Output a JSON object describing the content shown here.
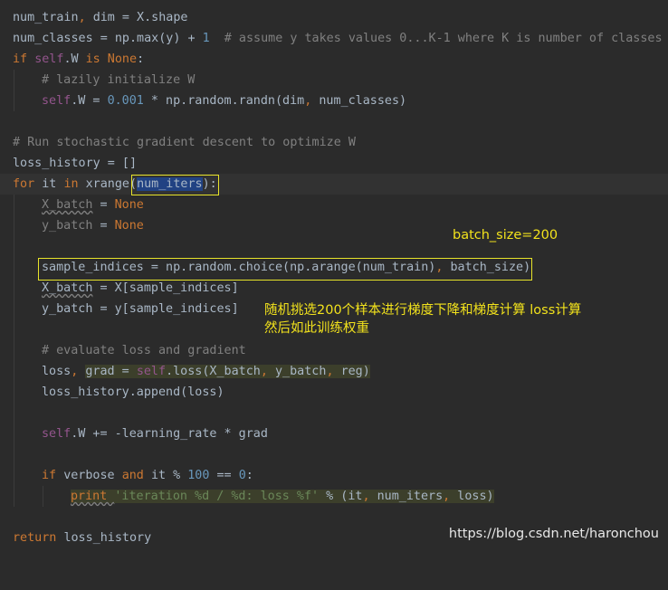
{
  "code": {
    "l1": {
      "a": "num_train",
      "b": ", ",
      "c": "dim = X.shape"
    },
    "l2": {
      "a": "num_classes = np.max(y) + ",
      "b": "1",
      "c": "  # assume y takes values 0...K-1 where K is number of classes"
    },
    "l3": {
      "a": "if ",
      "b": "self",
      "c": ".W ",
      "d": "is None",
      "e": ":"
    },
    "l4": {
      "a": "# lazily initialize W"
    },
    "l5": {
      "a": "self",
      "b": ".W = ",
      "c": "0.001",
      "d": " * np.random.randn(dim",
      "e": ", ",
      "f": "num_classes)"
    },
    "l7": {
      "a": "# Run stochastic gradient descent to optimize W"
    },
    "l8": {
      "a": "loss_history = []"
    },
    "l9": {
      "a": "for ",
      "b": "it ",
      "c": "in ",
      "d": "xrange(",
      "e": "num_iters",
      "f": "):"
    },
    "l10": {
      "a": "X_batch",
      "b": " = ",
      "c": "None"
    },
    "l11": {
      "a": "y_batch",
      "b": " = ",
      "c": "None"
    },
    "l13": {
      "a": "sample_indices = np.random.choice(np.arange(num_train)",
      "b": ", ",
      "c": "batch_size)"
    },
    "l14": {
      "a": "X_batch",
      "b": " = X[sample_indices]"
    },
    "l15": {
      "a": "y_batch = y[sample_indices]"
    },
    "l17": {
      "a": "# evaluate loss and gradient"
    },
    "l18": {
      "a": "loss",
      "b": ", ",
      "c": "grad = ",
      "d": "self",
      "e": ".loss(X_batch",
      "f": ", ",
      "g": "y_batch",
      "h": ", ",
      "i": "reg)"
    },
    "l19": {
      "a": "loss_history.append(loss)"
    },
    "l21": {
      "a": "self",
      "b": ".W += -learning_rate * grad"
    },
    "l23": {
      "a": "if ",
      "b": "verbose ",
      "c": "and ",
      "d": "it % ",
      "e": "100",
      "f": " == ",
      "g": "0",
      "h": ":"
    },
    "l24": {
      "a": "print ",
      "b": "'iteration %d / %d: loss %f'",
      "c": " % (it",
      "d": ", ",
      "e": "num_iters",
      "f": ", ",
      "g": "loss)"
    },
    "l26": {
      "a": "return ",
      "b": "loss_history"
    }
  },
  "annotations": {
    "batch_size": "batch_size=200",
    "desc_line1": "随机挑选200个样本进行梯度下降和梯度计算 loss计算",
    "desc_line2": "然后如此训练权重"
  },
  "watermark": "https://blog.csdn.net/haronchou",
  "colors": {
    "background": "#2b2b2b",
    "keyword": "#cc7832",
    "number": "#6897bb",
    "comment": "#808080",
    "self": "#94558d",
    "string": "#6a8759",
    "annotation": "#f2e21c"
  }
}
